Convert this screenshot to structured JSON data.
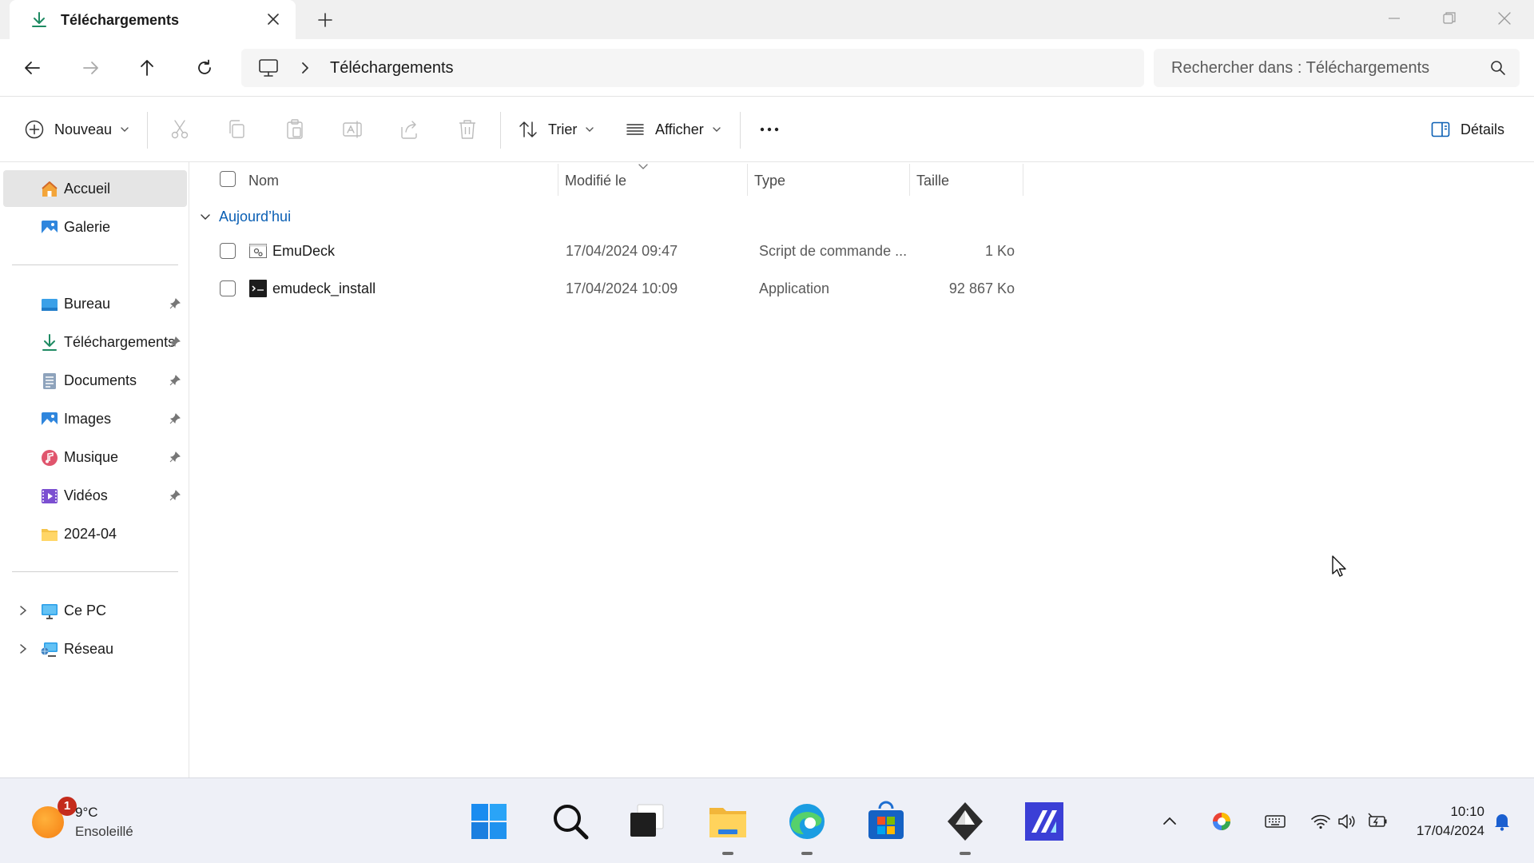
{
  "window": {
    "tab_title": "Téléchargements"
  },
  "address": {
    "crumb": "Téléchargements",
    "search_placeholder": "Rechercher dans : Téléchargements"
  },
  "commands": {
    "new_label": "Nouveau",
    "sort_label": "Trier",
    "view_label": "Afficher",
    "details_label": "Détails"
  },
  "sidebar": {
    "top": [
      {
        "label": "Accueil",
        "icon": "home-icon"
      },
      {
        "label": "Galerie",
        "icon": "gallery-icon"
      }
    ],
    "pinned": [
      {
        "label": "Bureau",
        "icon": "desktop-folder-icon"
      },
      {
        "label": "Téléchargements",
        "icon": "download-icon"
      },
      {
        "label": "Documents",
        "icon": "documents-icon"
      },
      {
        "label": "Images",
        "icon": "images-icon"
      },
      {
        "label": "Musique",
        "icon": "music-icon"
      },
      {
        "label": "Vidéos",
        "icon": "videos-icon"
      },
      {
        "label": "2024-04",
        "icon": "folder-icon"
      }
    ],
    "bottom": [
      {
        "label": "Ce PC",
        "icon": "computer-icon"
      },
      {
        "label": "Réseau",
        "icon": "network-icon"
      }
    ]
  },
  "list": {
    "columns": [
      "Nom",
      "Modifié le",
      "Type",
      "Taille"
    ],
    "group_label": "Aujourd’hui",
    "rows": [
      {
        "name": "EmuDeck",
        "modified": "17/04/2024 09:47",
        "type": "Script de commande ...",
        "size": "1 Ko",
        "icon": "script-file-icon"
      },
      {
        "name": "emudeck_install",
        "modified": "17/04/2024 10:09",
        "type": "Application",
        "size": "92 867 Ko",
        "icon": "app-file-icon"
      }
    ]
  },
  "taskbar": {
    "weather_badge": "1",
    "temperature": "9°C",
    "condition": "Ensoleillé",
    "time": "10:10",
    "date": "17/04/2024"
  },
  "colors": {
    "accent": "#0a5fb4",
    "selection": "#e5e5e5",
    "taskbar": "#eef0f7"
  }
}
